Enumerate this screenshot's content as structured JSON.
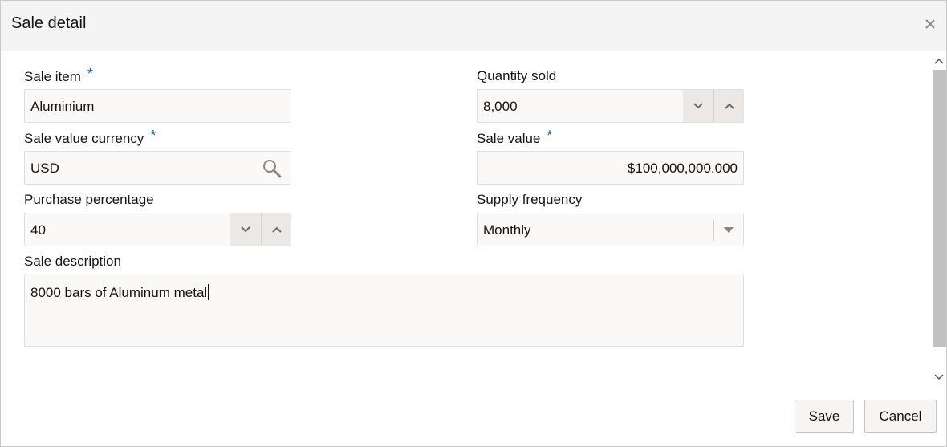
{
  "dialog": {
    "title": "Sale detail",
    "close_icon": "close-icon"
  },
  "form": {
    "sale_item": {
      "label": "Sale item",
      "required": "*",
      "value": "Aluminium"
    },
    "quantity_sold": {
      "label": "Quantity sold",
      "value": "8,000",
      "decrement_icon": "chevron-down-icon",
      "increment_icon": "chevron-up-icon"
    },
    "sale_value_currency": {
      "label": "Sale value currency",
      "required": "*",
      "value": "USD",
      "icon": "search-icon"
    },
    "sale_value": {
      "label": "Sale value",
      "required": "*",
      "value": "$100,000,000.000"
    },
    "purchase_percentage": {
      "label": "Purchase percentage",
      "value": "40",
      "decrement_icon": "chevron-down-icon",
      "increment_icon": "chevron-up-icon"
    },
    "supply_frequency": {
      "label": "Supply frequency",
      "value": "Monthly",
      "icon": "caret-down-icon"
    },
    "sale_description": {
      "label": "Sale description",
      "value": "8000 bars of Aluminum metal"
    }
  },
  "footer": {
    "save_label": "Save",
    "cancel_label": "Cancel"
  },
  "colors": {
    "required_marker": "#1f5da3",
    "header_bg": "#f4f4f4",
    "field_bg": "#fbf9f8",
    "spinner_bg": "#ebe8e5"
  }
}
